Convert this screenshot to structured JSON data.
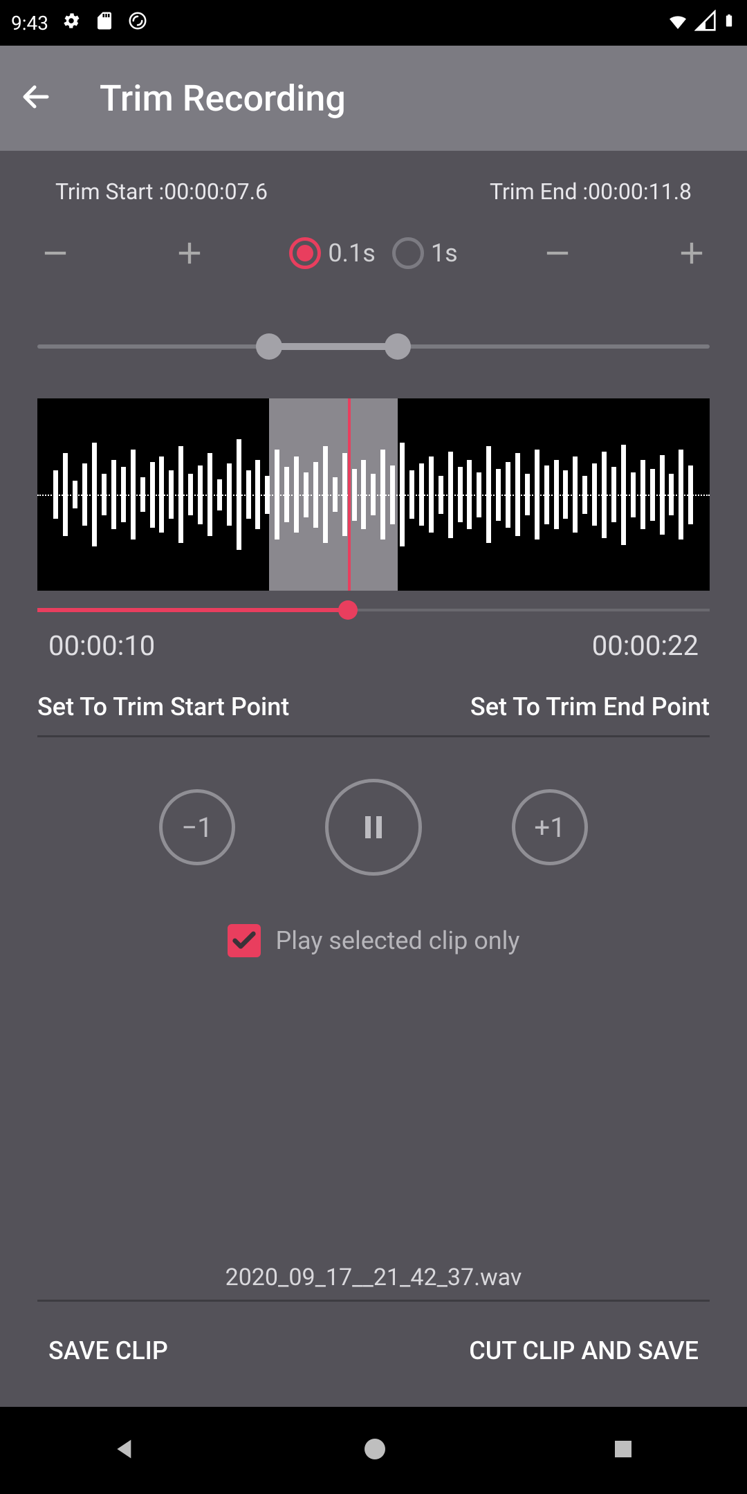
{
  "status": {
    "time": "9:43"
  },
  "header": {
    "title": "Trim Recording"
  },
  "trim": {
    "start_label": "Trim Start :",
    "start_value": "00:00:07.6",
    "end_label": "Trim End :",
    "end_value": "00:00:11.8"
  },
  "step": {
    "opt_fine": "0.1s",
    "opt_coarse": "1s",
    "selected": "fine"
  },
  "range": {
    "start_pct": 34.5,
    "end_pct": 53.6
  },
  "waveform": {
    "sel_start_pct": 34.5,
    "sel_end_pct": 53.6,
    "playhead_pct": 46.2
  },
  "progress": {
    "pct": 46.2
  },
  "time": {
    "current": "00:00:10",
    "total": "00:00:22"
  },
  "set": {
    "start": "Set To Trim Start Point",
    "end": "Set To Trim End Point"
  },
  "playback": {
    "back": "−1",
    "fwd": "+1",
    "state": "playing"
  },
  "clip_only": {
    "label": "Play selected clip only",
    "checked": true
  },
  "filename": "2020_09_17__21_42_37.wav",
  "actions": {
    "save": "SAVE CLIP",
    "cut": "CUT CLIP AND SAVE"
  }
}
